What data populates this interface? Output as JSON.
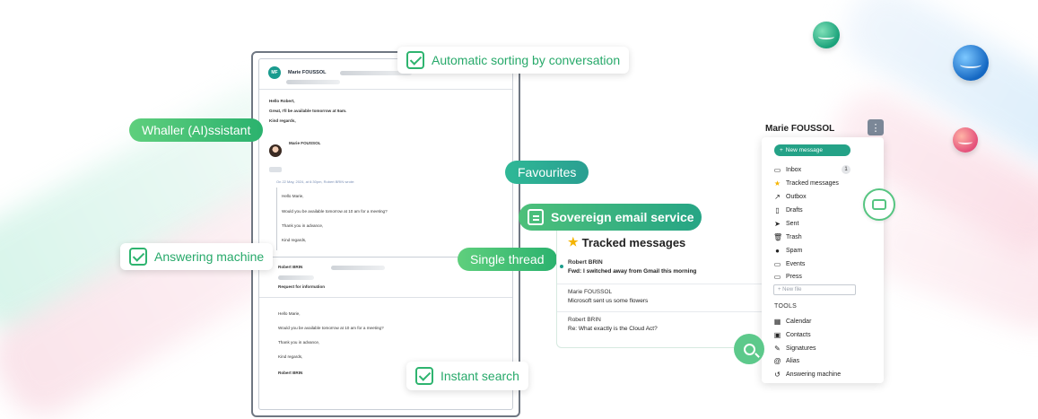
{
  "callouts": {
    "sorting": "Automatic sorting by conversation",
    "answering": "Answering machine",
    "search": "Instant search"
  },
  "pills": {
    "assistant": "Whaller (AI)ssistant",
    "favourites": "Favourites",
    "single_thread": "Single thread",
    "sovereign": "Sovereign email service"
  },
  "mail": {
    "avatar_initials": "MF",
    "sender": "Marie FOUSSOL",
    "body_lines": [
      "Hello Robert,",
      "Great, I'll be available tomorrow at 9am.",
      "Kind regards,"
    ],
    "signature_name": "Marie FOUSSOL",
    "quote_header": "On 22 May, 2024, at 6:30pm, Robert BRIN wrote:",
    "quote_lines": [
      "Hello Marie,",
      "Would you be available tomorrow at 10 am for a meeting?",
      "Thank you in advance,",
      "Kind regards,"
    ],
    "second": {
      "sender": "Robert BRIN",
      "subject": "Request for information",
      "body_lines": [
        "Hello Marie,",
        "Would you be available tomorrow at 10 am for a meeting?",
        "Thank you in advance,",
        "Kind regards,"
      ],
      "signature": "Robert BRIN"
    }
  },
  "tracked": {
    "title": "Tracked messages",
    "items": [
      {
        "from": "Robert BRIN",
        "subject": "Fwd: I switched away from Gmail this morning",
        "unread": true
      },
      {
        "from": "Marie FOUSSOL",
        "subject": "Microsoft sent us some flowers",
        "unread": false
      },
      {
        "from": "Robert BRIN",
        "subject": "Re: What exactly is the Cloud Act?",
        "unread": false
      }
    ]
  },
  "sidebar": {
    "user": "Marie FOUSSOL",
    "new_message": "New message",
    "inbox_count": "1",
    "items": [
      {
        "label": "Inbox",
        "icon": "inbox-icon",
        "glyph": "▭"
      },
      {
        "label": "Tracked messages",
        "icon": "star-icon",
        "glyph": "★"
      },
      {
        "label": "Outbox",
        "icon": "outbox-icon",
        "glyph": "↗"
      },
      {
        "label": "Drafts",
        "icon": "draft-icon",
        "glyph": "▯"
      },
      {
        "label": "Sent",
        "icon": "send-icon",
        "glyph": "➤"
      },
      {
        "label": "Trash",
        "icon": "trash-icon",
        "glyph": "🗑"
      },
      {
        "label": "Spam",
        "icon": "spam-icon",
        "glyph": "●"
      },
      {
        "label": "Events",
        "icon": "folder-icon",
        "glyph": "▭"
      },
      {
        "label": "Press",
        "icon": "folder-icon",
        "glyph": "▭"
      }
    ],
    "new_file": "+ New file",
    "tools_title": "TOOLS",
    "tools": [
      {
        "label": "Calendar",
        "icon": "calendar-icon",
        "glyph": "▦"
      },
      {
        "label": "Contacts",
        "icon": "contacts-icon",
        "glyph": "▣"
      },
      {
        "label": "Signatures",
        "icon": "signature-icon",
        "glyph": "✎"
      },
      {
        "label": "Alias",
        "icon": "at-icon",
        "glyph": "@"
      },
      {
        "label": "Answering machine",
        "icon": "answering-icon",
        "glyph": "↺"
      }
    ]
  },
  "colors": {
    "brand_green": "#2bb26e",
    "brand_teal": "#24a287"
  }
}
